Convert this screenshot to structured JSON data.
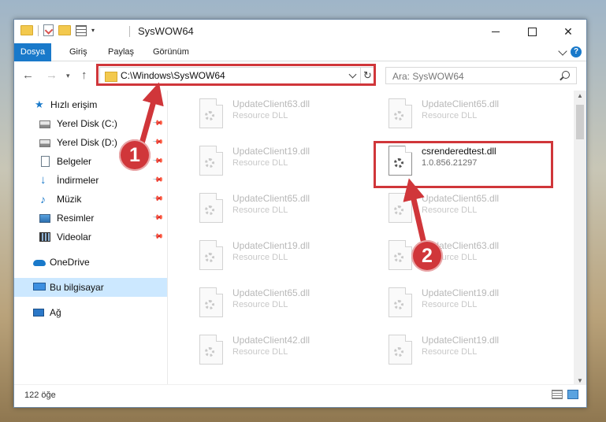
{
  "window": {
    "title": "SysWOW64",
    "minimize": "—",
    "maximize": "☐",
    "close": "✕"
  },
  "ribbon": {
    "tabs": [
      "Dosya",
      "Giriş",
      "Paylaş",
      "Görünüm"
    ],
    "help": "?"
  },
  "navigation": {
    "back": "←",
    "forward": "→",
    "recent": "▾",
    "up": "↑",
    "address": "C:\\Windows\\SysWOW64",
    "refresh": "↻",
    "search_placeholder": "Ara: SysWOW64"
  },
  "sidebar": {
    "items": [
      {
        "label": "Hızlı erişim",
        "icon": "quick-access-icon"
      },
      {
        "label": "Yerel Disk (C:)",
        "icon": "drive-icon",
        "pinned": true
      },
      {
        "label": "Yerel Disk (D:)",
        "icon": "drive-icon",
        "pinned": true
      },
      {
        "label": "Belgeler",
        "icon": "documents-icon",
        "pinned": true
      },
      {
        "label": "İndirmeler",
        "icon": "downloads-icon",
        "pinned": true
      },
      {
        "label": "Müzik",
        "icon": "music-icon",
        "pinned": true
      },
      {
        "label": "Resimler",
        "icon": "pictures-icon",
        "pinned": true
      },
      {
        "label": "Videolar",
        "icon": "videos-icon",
        "pinned": true
      },
      {
        "label": "OneDrive",
        "icon": "onedrive-icon"
      },
      {
        "label": "Bu bilgisayar",
        "icon": "this-pc-icon",
        "selected": true
      },
      {
        "label": "Ağ",
        "icon": "network-icon"
      }
    ],
    "pin_glyph": "📌"
  },
  "files": [
    {
      "name": "UpdateClient63.dll",
      "type": "Resource DLL"
    },
    {
      "name": "UpdateClient65.dll",
      "type": "Resource DLL"
    },
    {
      "name": "UpdateClient19.dll",
      "type": "Resource DLL"
    },
    {
      "name": "csrenderedtest.dll",
      "type": "1.0.856.21297",
      "active": true
    },
    {
      "name": "UpdateClient65.dll",
      "type": "Resource DLL"
    },
    {
      "name": "UpdateClient65.dll",
      "type": "Resource DLL"
    },
    {
      "name": "UpdateClient19.dll",
      "type": "Resource DLL"
    },
    {
      "name": "UpdateClient63.dll",
      "type": "Resource DLL"
    },
    {
      "name": "UpdateClient65.dll",
      "type": "Resource DLL"
    },
    {
      "name": "UpdateClient19.dll",
      "type": "Resource DLL"
    },
    {
      "name": "UpdateClient42.dll",
      "type": "Resource DLL"
    },
    {
      "name": "UpdateClient19.dll",
      "type": "Resource DLL"
    }
  ],
  "status": {
    "item_count": "122 öğe"
  },
  "callouts": [
    "1",
    "2"
  ],
  "colors": {
    "accent": "#1979ca",
    "highlight": "#d0363a",
    "selected_bg": "#cce8ff"
  }
}
